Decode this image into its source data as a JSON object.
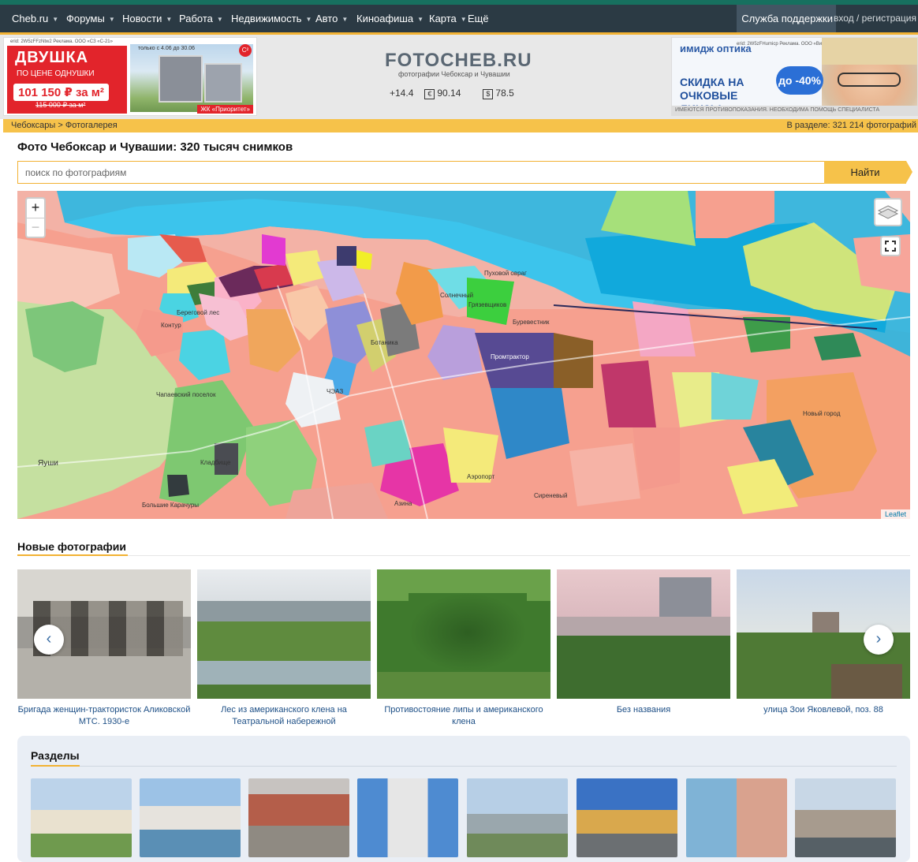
{
  "nav": {
    "items": [
      {
        "label": "Cheb.ru",
        "chevron": true
      },
      {
        "label": "Форумы",
        "chevron": true
      },
      {
        "label": "Новости",
        "chevron": true
      },
      {
        "label": "Работа",
        "chevron": true
      },
      {
        "label": "Недвижимость",
        "chevron": true
      },
      {
        "label": "Авто",
        "chevron": true
      },
      {
        "label": "Киноафиша",
        "chevron": true
      },
      {
        "label": "Карта",
        "chevron": true
      },
      {
        "label": "Ещё",
        "chevron": false
      }
    ],
    "support": "Служба поддержки",
    "login": "вход / регистрация"
  },
  "ad_left": {
    "erid": "erid: 2W5zFFzNtw2 Реклама. ООО «СЗ «С-21»",
    "headline": "ДВУШКА",
    "subline": "ПО ЦЕНЕ ОДНУШКИ",
    "price": "101 150 ₽ за м²",
    "old_price": "115 000 ₽ за м²",
    "dates": "только с 4.06 до 30.06",
    "project": "ЖК «Приоритет»",
    "badge": "C²"
  },
  "site": {
    "logo": "FOTOCHEB.RU",
    "tagline": "фотографии Чебоксар и Чувашии",
    "temperature": "+14.4",
    "euro_icon": "€",
    "euro": "90.14",
    "usd_icon": "$",
    "usd": "78.5"
  },
  "ad_right": {
    "brand": "имидж оптика",
    "erid": "erid: 2W5zFHumicp Реклама. ООО «Визуал»",
    "promo": "СКИДКА НА ОЧКОВЫЕ ЛИНЗЫ",
    "discount": "до -40%",
    "warning": "ИМЕЮТСЯ ПРОТИВОПОКАЗАНИЯ. НЕОБХОДИМА ПОМОЩЬ СПЕЦИАЛИСТА"
  },
  "breadcrumb": {
    "path": "Чебоксары > Фотогалерея",
    "count": "В разделе: 321 214 фотографий"
  },
  "page": {
    "title": "Фото Чебоксар и Чувашии: 320 тысяч снимков"
  },
  "search": {
    "placeholder": "поиск по фотографиям",
    "button": "Найти"
  },
  "map": {
    "zoom_in": "+",
    "zoom_out": "−",
    "attribution": "Leaflet",
    "labels": [
      "Пуховой овраг",
      "Грязевщиков",
      "Промтрактор",
      "Буревестник",
      "Солнечный",
      "Ботаника",
      "ЧЭАЗ",
      "Кладбище",
      "Аэропорт",
      "Сиреневый",
      "Большие Карачуры",
      "Чапаевский поселок",
      "Береговой лес",
      "Контур",
      "Азина",
      "Яуши",
      "Новый город"
    ]
  },
  "new_photos": {
    "title": "Новые фотографии",
    "prev": "‹",
    "next": "›",
    "items": [
      {
        "caption": "Бригада женщин-трактористок Аликовской МТС. 1930-е"
      },
      {
        "caption": "Лес из американского клена на Театральной набережной"
      },
      {
        "caption": "Противостояние липы и американского клена"
      },
      {
        "caption": "Без названия"
      },
      {
        "caption": "улица Зои Яковлевой, поз. 88"
      }
    ]
  },
  "sections": {
    "title": "Разделы"
  },
  "colors": {
    "nav_bg": "#2b3a44",
    "accent": "#f2b233",
    "link": "#1d4f86"
  }
}
